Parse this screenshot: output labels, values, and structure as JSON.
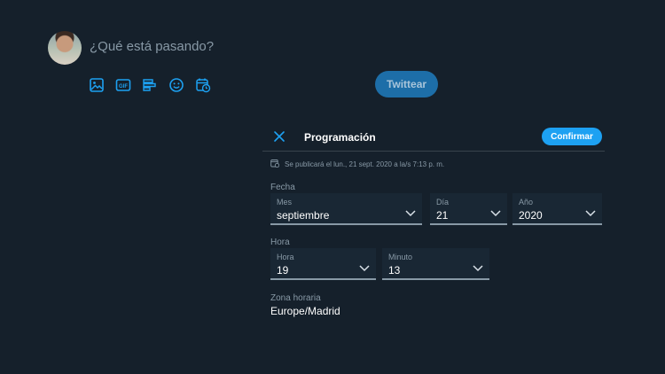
{
  "compose": {
    "placeholder": "¿Qué está pasando?",
    "tools": [
      "image-icon",
      "gif-icon",
      "poll-icon",
      "emoji-icon",
      "schedule-icon"
    ],
    "tweet_label": "Twittear"
  },
  "schedule": {
    "title": "Programación",
    "confirm_label": "Confirmar",
    "note": "Se publicará el lun., 21 sept. 2020 a la/s 7:13 p. m.",
    "date": {
      "section_label": "Fecha",
      "month": {
        "label": "Mes",
        "value": "septiembre"
      },
      "day": {
        "label": "Día",
        "value": "21"
      },
      "year": {
        "label": "Año",
        "value": "2020"
      }
    },
    "time": {
      "section_label": "Hora",
      "hour": {
        "label": "Hora",
        "value": "19"
      },
      "minute": {
        "label": "Minuto",
        "value": "13"
      }
    },
    "timezone": {
      "label": "Zona horaria",
      "value": "Europe/Madrid"
    }
  },
  "colors": {
    "background": "#15202b",
    "accent": "#1da1f2",
    "muted_text": "#8899a6",
    "field_bg": "#192734"
  }
}
